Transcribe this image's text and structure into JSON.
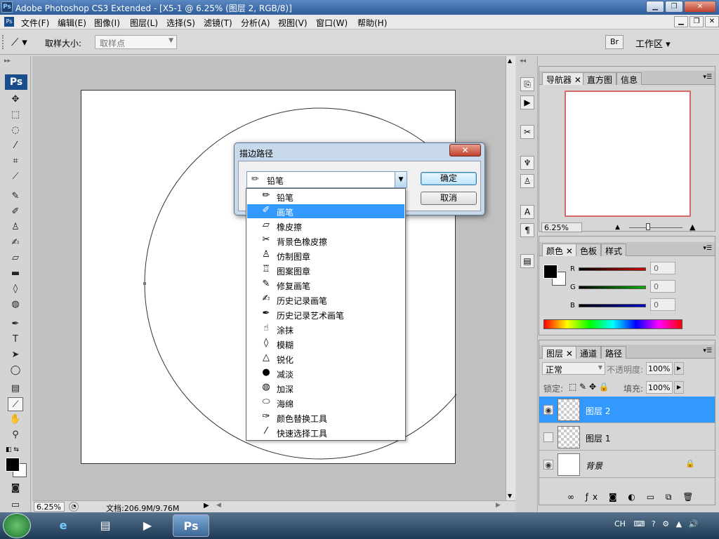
{
  "window": {
    "title": "Adobe Photoshop CS3 Extended - [X5-1 @ 6.25% (图层 2, RGB/8)]",
    "app_badge": "Ps"
  },
  "menu": [
    "文件(F)",
    "编辑(E)",
    "图像(I)",
    "图层(L)",
    "选择(S)",
    "滤镜(T)",
    "分析(A)",
    "视图(V)",
    "窗口(W)",
    "帮助(H)"
  ],
  "options": {
    "label": "取样大小:",
    "select_value": "取样点",
    "workspace": "工作区 ▾"
  },
  "toolbox": {
    "logo": "Ps"
  },
  "status": {
    "zoom": "6.25%",
    "doc_info": "文档:206.9M/9.76M"
  },
  "dialog": {
    "title": "描边路径",
    "close": "✕",
    "tool_value": "铅笔",
    "ok": "确定",
    "cancel": "取消"
  },
  "dropdown": {
    "items": [
      {
        "label": "铅笔",
        "icon": "pencil-icon"
      },
      {
        "label": "画笔",
        "icon": "brush-icon",
        "selected": true
      },
      {
        "label": "橡皮擦",
        "icon": "eraser-icon"
      },
      {
        "label": "背景色橡皮擦",
        "icon": "background-eraser-icon"
      },
      {
        "label": "仿制图章",
        "icon": "clone-stamp-icon"
      },
      {
        "label": "图案图章",
        "icon": "pattern-stamp-icon"
      },
      {
        "label": "修复画笔",
        "icon": "healing-brush-icon"
      },
      {
        "label": "历史记录画笔",
        "icon": "history-brush-icon"
      },
      {
        "label": "历史记录艺术画笔",
        "icon": "art-history-brush-icon"
      },
      {
        "label": "涂抹",
        "icon": "smudge-icon"
      },
      {
        "label": "模糊",
        "icon": "blur-icon"
      },
      {
        "label": "锐化",
        "icon": "sharpen-icon"
      },
      {
        "label": "减淡",
        "icon": "dodge-icon"
      },
      {
        "label": "加深",
        "icon": "burn-icon"
      },
      {
        "label": "海绵",
        "icon": "sponge-icon"
      },
      {
        "label": "颜色替换工具",
        "icon": "color-replacement-icon"
      },
      {
        "label": "快速选择工具",
        "icon": "quick-selection-icon"
      }
    ]
  },
  "navigator": {
    "tabs": [
      "导航器",
      "直方图",
      "信息"
    ],
    "zoom": "6.25%"
  },
  "color": {
    "tabs": [
      "颜色",
      "色板",
      "样式"
    ],
    "channels": [
      {
        "label": "R",
        "value": "0",
        "color": "#d40000"
      },
      {
        "label": "G",
        "value": "0",
        "color": "#00b000"
      },
      {
        "label": "B",
        "value": "0",
        "color": "#0000d0"
      }
    ]
  },
  "layers": {
    "tabs": [
      "图层",
      "通道",
      "路径"
    ],
    "blend": "正常",
    "opacity_label": "不透明度:",
    "opacity": "100%",
    "lock_label": "锁定:",
    "fill_label": "填充:",
    "fill": "100%",
    "items": [
      {
        "name": "图层 2",
        "active": true,
        "visible": true
      },
      {
        "name": "图层 1",
        "active": false,
        "visible": false
      },
      {
        "name": "背景",
        "active": false,
        "visible": true,
        "locked": true
      }
    ]
  },
  "tray": {
    "lang": "CH"
  }
}
